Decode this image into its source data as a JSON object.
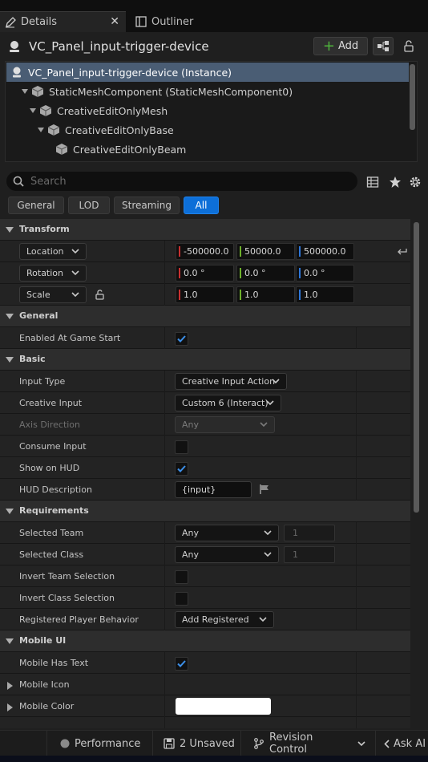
{
  "tabs": [
    {
      "label": "Details",
      "icon": "pencil-icon"
    },
    {
      "label": "Outliner",
      "icon": "outliner-icon"
    }
  ],
  "header": {
    "title": "VC_Panel_input-trigger-device",
    "add_label": "Add"
  },
  "tree": [
    {
      "label": "VC_Panel_input-trigger-device (Instance)",
      "selected": true
    },
    {
      "label": "StaticMeshComponent (StaticMeshComponent0)"
    },
    {
      "label": "CreativeEditOnlyMesh"
    },
    {
      "label": "CreativeEditOnlyBase"
    },
    {
      "label": "CreativeEditOnlyBeam"
    }
  ],
  "search": {
    "placeholder": "Search"
  },
  "filters": [
    "General",
    "LOD",
    "Streaming",
    "All"
  ],
  "active_filter": "All",
  "transform": {
    "category": "Transform",
    "location": {
      "label": "Location",
      "x": "-500000.0",
      "y": "50000.0",
      "z": "500000.0"
    },
    "rotation": {
      "label": "Rotation",
      "x": "0.0 °",
      "y": "0.0 °",
      "z": "0.0 °"
    },
    "scale": {
      "label": "Scale",
      "x": "1.0",
      "y": "1.0",
      "z": "1.0"
    }
  },
  "general": {
    "category": "General",
    "enabled_at_game_start": "Enabled At Game Start"
  },
  "basic": {
    "category": "Basic",
    "input_type": {
      "label": "Input Type",
      "value": "Creative Input Action"
    },
    "creative_input": {
      "label": "Creative Input",
      "value": "Custom 6 (Interact)"
    },
    "axis_direction": {
      "label": "Axis Direction",
      "value": "Any"
    },
    "consume_input": "Consume Input",
    "show_on_hud": "Show on HUD",
    "hud_description": {
      "label": "HUD Description",
      "value": "{input}"
    }
  },
  "requirements": {
    "category": "Requirements",
    "selected_team": {
      "label": "Selected Team",
      "value": "Any",
      "index": "1"
    },
    "selected_class": {
      "label": "Selected Class",
      "value": "Any",
      "index": "1"
    },
    "invert_team": "Invert Team Selection",
    "invert_class": "Invert Class Selection",
    "registered_player_behavior": {
      "label": "Registered Player Behavior",
      "value": "Add Registered"
    }
  },
  "mobile_ui": {
    "category": "Mobile UI",
    "mobile_has_text": "Mobile Has Text",
    "mobile_icon": "Mobile Icon",
    "mobile_color": {
      "label": "Mobile Color",
      "color": "#ffffff"
    }
  },
  "status_bar": {
    "performance": "Performance",
    "unsaved": "2 Unsaved",
    "revision_control": "Revision Control",
    "ask_ai": "Ask AI"
  },
  "colors": {
    "accent": "#0d6fd8",
    "selection": "#4a5d74",
    "x_axis": "#c93030",
    "y_axis": "#6db02b",
    "z_axis": "#2d76d8"
  }
}
